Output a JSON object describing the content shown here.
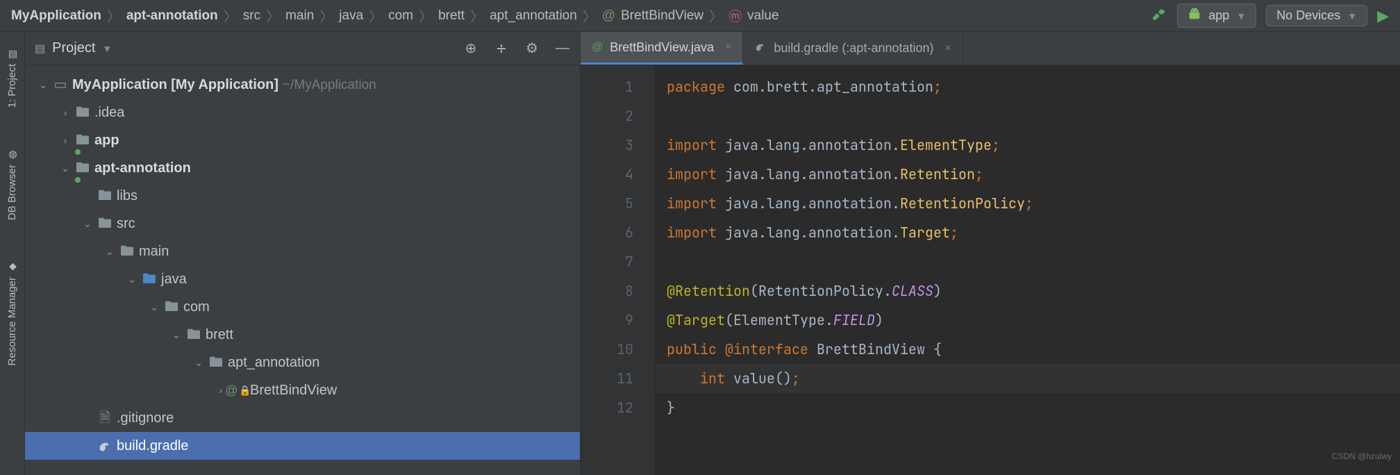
{
  "breadcrumb": {
    "items": [
      "MyApplication",
      "apt-annotation",
      "src",
      "main",
      "java",
      "com",
      "brett",
      "apt_annotation",
      "BrettBindView",
      "value"
    ]
  },
  "toolbar": {
    "config_label": "app",
    "device_label": "No Devices"
  },
  "rail": {
    "project": "1: Project",
    "db": "DB Browser",
    "res": "Resource Manager"
  },
  "project_panel": {
    "title": "Project"
  },
  "tree": {
    "root": "MyApplication",
    "root_desc": "[My Application]",
    "root_path": "~/MyApplication",
    "idea": ".idea",
    "app": "app",
    "apt": "apt-annotation",
    "libs": "libs",
    "src": "src",
    "main": "main",
    "java": "java",
    "com": "com",
    "brett": "brett",
    "apt_pkg": "apt_annotation",
    "bind": "BrettBindView",
    "gitignore": ".gitignore",
    "buildgradle": "build.gradle"
  },
  "tabs": {
    "t0": "BrettBindView.java",
    "t1": "build.gradle (:apt-annotation)"
  },
  "code": {
    "lines": [
      "1",
      "2",
      "3",
      "4",
      "5",
      "6",
      "7",
      "8",
      "9",
      "10",
      "11",
      "12"
    ],
    "l1_kw": "package ",
    "l1_pkg": "com.brett.apt_annotation",
    "l3_kw": "import ",
    "l3_a": "java.lang.annotation.",
    "l3_b": "ElementType",
    "l4_a": "java.lang.annotation.",
    "l4_b": "Retention",
    "l5_a": "java.lang.annotation.",
    "l5_b": "RetentionPolicy",
    "l6_a": "java.lang.annotation.",
    "l6_b": "Target",
    "l8_a": "@Retention",
    "l8_b": "(RetentionPolicy.",
    "l8_c": "CLASS",
    "l8_d": ")",
    "l9_a": "@Target",
    "l9_b": "(ElementType.",
    "l9_c": "FIELD",
    "l9_d": ")",
    "l10_a": "public ",
    "l10_b": "@interface ",
    "l10_c": "BrettBindView ",
    "l10_d": "{",
    "l11_a": "    int ",
    "l11_b": "value",
    "l11_c": "()",
    "l11_d": ";",
    "l12": "}"
  },
  "watermark": "CSDN @hzulwy"
}
